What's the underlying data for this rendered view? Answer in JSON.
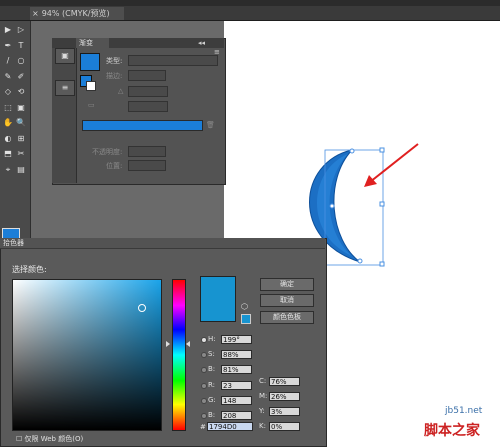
{
  "document": {
    "tab_close": "×",
    "tab_title": "94% (CMYK/预览)"
  },
  "toolbar": {
    "tools": [
      "▶",
      "▷",
      "✒",
      "T",
      "/",
      "○",
      "✎",
      "✐",
      "◇",
      "⟲",
      "⬚",
      "▣",
      "✋",
      "🔍",
      "◐",
      "⊞",
      "⬒",
      "✂",
      "⌖",
      "▤"
    ],
    "fill_color": "#1b7ed8"
  },
  "gradient_panel": {
    "tab_label": "渐变",
    "type_label": "类型:",
    "stroke_label": "描边:",
    "angle_label": "△",
    "ratio_label": "▭",
    "opacity_label": "不透明度:",
    "location_label": "位置:",
    "gradient_color": "#1b7ed8",
    "collapse": "◂◂",
    "menu": "≡"
  },
  "color_picker": {
    "title": "拾色器",
    "select_label": "选择颜色:",
    "ok_label": "确定",
    "cancel_label": "取消",
    "swatches_label": "颜色色板",
    "current_color": "#1794d0",
    "hsb": [
      {
        "label": "H:",
        "value": "199°"
      },
      {
        "label": "S:",
        "value": "88%"
      },
      {
        "label": "B:",
        "value": "81%"
      }
    ],
    "rgb": [
      {
        "label": "R:",
        "value": "23"
      },
      {
        "label": "G:",
        "value": "148"
      },
      {
        "label": "B:",
        "value": "208"
      }
    ],
    "cmyk": [
      {
        "label": "C:",
        "value": "76%"
      },
      {
        "label": "M:",
        "value": "26%"
      },
      {
        "label": "Y:",
        "value": "3%"
      },
      {
        "label": "K:",
        "value": "0%"
      }
    ],
    "hex_label": "#",
    "hex_value": "1794D0",
    "web_only_label": "仅限 Web 颜色(O)"
  },
  "watermark": {
    "site": "jb51.net",
    "name": "脚本之家"
  }
}
